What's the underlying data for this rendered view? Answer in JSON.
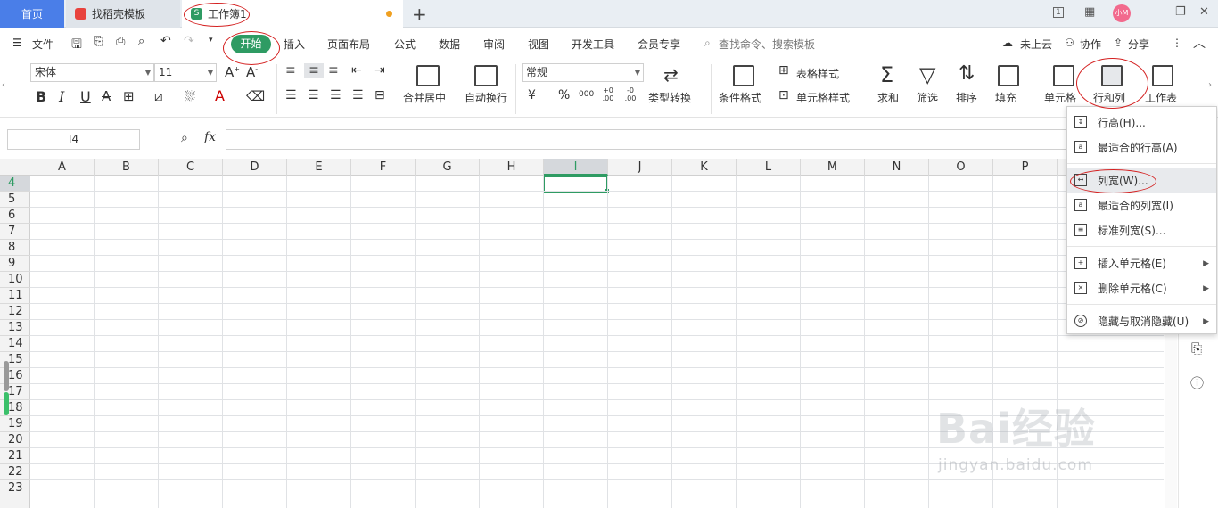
{
  "titlebar": {
    "tabs": [
      {
        "label": "首页"
      },
      {
        "label": "找稻壳模板"
      },
      {
        "label": "工作簿1"
      }
    ],
    "avatar_text": "小M",
    "colors": {
      "home_tab": "#4a7ee8",
      "accent": "#2e9b63",
      "annotation": "#d42020"
    }
  },
  "menu": {
    "file": "文件",
    "tabs": [
      "开始",
      "插入",
      "页面布局",
      "公式",
      "数据",
      "审阅",
      "视图",
      "开发工具",
      "会员专享"
    ],
    "search": "查找命令、搜索模板",
    "cloud": "未上云",
    "collab": "协作",
    "share": "分享"
  },
  "ribbon": {
    "font_name": "宋体",
    "font_size": "11",
    "bold": "B",
    "italic": "I",
    "underline": "U",
    "font_grow": "A⁺",
    "font_shrink": "A⁻",
    "merge_center": "合并居中",
    "wrap_text": "自动换行",
    "number_format": "常规",
    "currency": "¥",
    "percent": "%",
    "thousands": "000",
    "inc_decimal": "+0 .00",
    "dec_decimal": "-0 .00",
    "type_convert": "类型转换",
    "cond_format": "条件格式",
    "table_style": "表格样式",
    "cell_style": "单元格样式",
    "sum": "求和",
    "filter": "筛选",
    "sort": "排序",
    "fill": "填充",
    "cell": "单元格",
    "row_col": "行和列",
    "worksheet": "工作表"
  },
  "formula_bar": {
    "name_box": "I4",
    "fx": "fx"
  },
  "grid": {
    "columns": [
      "A",
      "B",
      "C",
      "D",
      "E",
      "F",
      "G",
      "H",
      "I",
      "J",
      "K",
      "L",
      "M",
      "N",
      "O",
      "P"
    ],
    "rows": [
      "4",
      "5",
      "6",
      "7",
      "8",
      "9",
      "10",
      "11",
      "12",
      "13",
      "14",
      "15",
      "16",
      "17",
      "18",
      "19",
      "20",
      "21",
      "22",
      "23"
    ],
    "selected_column": "I",
    "selected_row": "4"
  },
  "dropdown": {
    "items": [
      {
        "label": "行高(H)...",
        "icon": "row-height-icon"
      },
      {
        "label": "最适合的行高(A)",
        "icon": "autofit-row-icon"
      },
      {
        "label": "列宽(W)...",
        "icon": "column-width-icon"
      },
      {
        "label": "最适合的列宽(I)",
        "icon": "autofit-column-icon"
      },
      {
        "label": "标准列宽(S)...",
        "icon": "standard-width-icon"
      },
      {
        "label": "插入单元格(E)",
        "icon": "insert-cell-icon"
      },
      {
        "label": "删除单元格(C)",
        "icon": "delete-cell-icon"
      },
      {
        "label": "隐藏与取消隐藏(U)",
        "icon": "hide-icon"
      }
    ]
  },
  "watermark": {
    "brand": "Bai经验",
    "url": "jingyan.baidu.com"
  }
}
